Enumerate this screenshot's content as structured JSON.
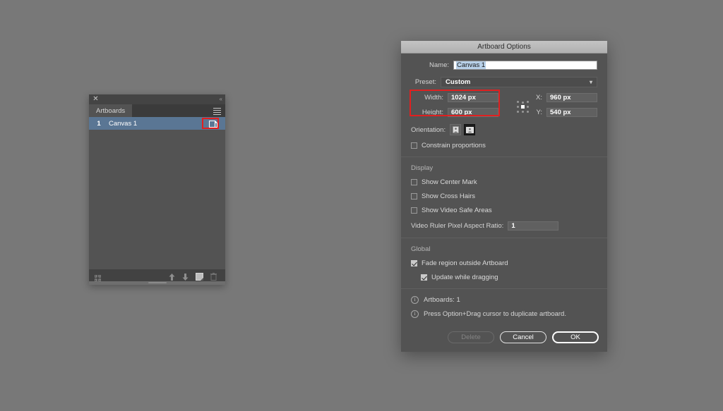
{
  "panel": {
    "close_icon": "close-icon",
    "collapse_icon": "collapse-icon",
    "tab_label": "Artboards",
    "menu_icon": "panel-menu-icon",
    "artboards": [
      {
        "number": "1",
        "name": "Canvas 1",
        "artboard_icon": "artboard-options-icon"
      }
    ],
    "footer": {
      "rearrange_icon": "rearrange-artboards-icon",
      "move_up_icon": "move-up-icon",
      "move_down_icon": "move-down-icon",
      "new_artboard_icon": "new-artboard-icon",
      "delete_artboard_icon": "delete-artboard-icon"
    }
  },
  "dialog": {
    "title": "Artboard Options",
    "name": {
      "label": "Name:",
      "value": "Canvas 1"
    },
    "preset": {
      "label": "Preset:",
      "value": "Custom",
      "chevron_icon": "chevron-down-icon"
    },
    "dimensions": {
      "width_label": "Width:",
      "width_value": "1024 px",
      "height_label": "Height:",
      "height_value": "600 px",
      "x_label": "X:",
      "x_value": "960 px",
      "y_label": "Y:",
      "y_value": "540 px",
      "reference_point_icon": "reference-point-widget"
    },
    "orientation": {
      "label": "Orientation:",
      "portrait_icon": "portrait-orientation-icon",
      "landscape_icon": "landscape-orientation-icon"
    },
    "constrain": {
      "label": "Constrain proportions",
      "checked": false
    },
    "display": {
      "heading": "Display",
      "options": [
        {
          "label": "Show Center Mark",
          "checked": false
        },
        {
          "label": "Show Cross Hairs",
          "checked": false
        },
        {
          "label": "Show Video Safe Areas",
          "checked": false
        }
      ],
      "video_ratio_label": "Video Ruler Pixel Aspect Ratio:",
      "video_ratio_value": "1"
    },
    "global": {
      "heading": "Global",
      "fade_label": "Fade region outside Artboard",
      "fade_checked": true,
      "update_label": "Update while dragging",
      "update_checked": true
    },
    "info": [
      {
        "icon": "info-icon",
        "text": "Artboards: 1"
      },
      {
        "icon": "info-icon",
        "text": "Press Option+Drag cursor to duplicate artboard."
      }
    ],
    "buttons": {
      "delete": "Delete",
      "cancel": "Cancel",
      "ok": "OK"
    }
  },
  "annotations": {
    "highlight_color": "#e02020"
  },
  "colors": {
    "background": "#787878",
    "dialog_body": "#535353",
    "dialog_title_bar": "#b8b8b8",
    "panel_body": "#535353",
    "row_selected": "#5a7694"
  }
}
